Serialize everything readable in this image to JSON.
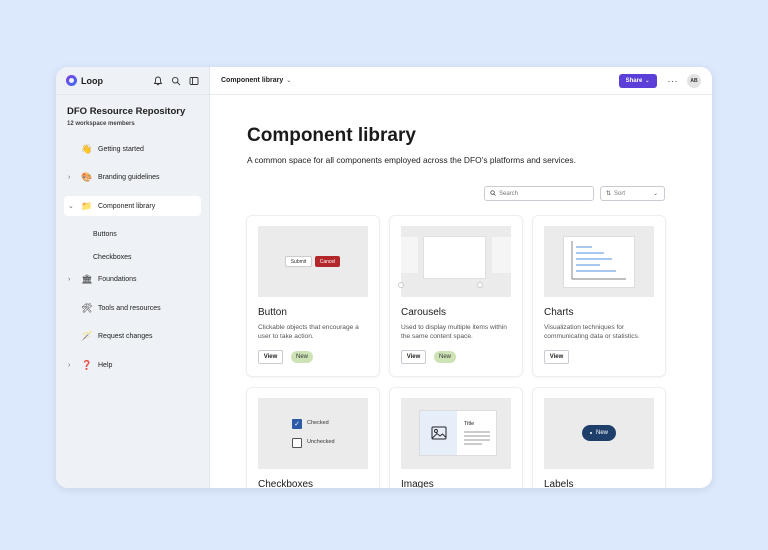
{
  "app": {
    "name": "Loop"
  },
  "workspace": {
    "title": "DFO Resource Repository",
    "members": "12 workspace members"
  },
  "sidebar": {
    "items": [
      {
        "label": "Getting started",
        "emoji": "👋"
      },
      {
        "label": "Branding guidelines",
        "emoji": "🎨"
      },
      {
        "label": "Component library",
        "emoji": "📁"
      },
      {
        "label": "Foundations",
        "emoji": "🏛"
      },
      {
        "label": "Tools and resources",
        "emoji": "🛠"
      },
      {
        "label": "Request changes",
        "emoji": "🪄"
      },
      {
        "label": "Help",
        "emoji": "❓"
      }
    ],
    "sub_items": [
      "Buttons",
      "Checkboxes"
    ]
  },
  "topbar": {
    "breadcrumb": "Component library",
    "share": "Share",
    "more": "···",
    "avatar": "AB"
  },
  "page": {
    "title": "Component library",
    "description": "A common space for all components employed across the DFO’s platforms and services."
  },
  "search": {
    "placeholder": "Search"
  },
  "sort": {
    "label": "Sort"
  },
  "cards": [
    {
      "title": "Button",
      "desc": "Clickable objects that encourage a user to take action.",
      "view": "View",
      "badge": "New"
    },
    {
      "title": "Carousels",
      "desc": "Used to display multiple items within the same content space.",
      "view": "View",
      "badge": "New"
    },
    {
      "title": "Charts",
      "desc": "Visualization techniques for communicating data or statistics.",
      "view": "View"
    },
    {
      "title": "Checkboxes"
    },
    {
      "title": "Images"
    },
    {
      "title": "Labels"
    }
  ],
  "previews": {
    "submit": "Submit",
    "cancel": "Cancel",
    "checked": "Checked",
    "unchecked": "Unchecked",
    "image_title": "Title",
    "new_label": "New"
  },
  "colors": {
    "accent": "#5b3fd8",
    "cancel": "#b3262a",
    "badge": "#cde3b5",
    "label_pill": "#1f3f6b"
  }
}
